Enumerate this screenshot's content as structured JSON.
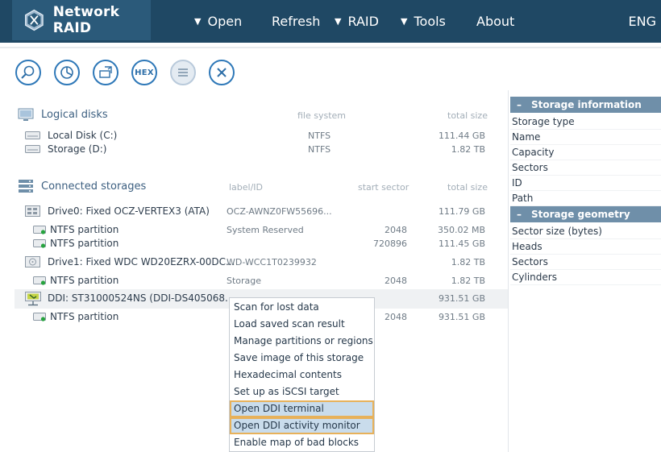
{
  "app": {
    "title": "Network RAID"
  },
  "menu": {
    "open": "Open",
    "refresh": "Refresh",
    "raid": "RAID",
    "tools": "Tools",
    "about": "About",
    "lang": "ENG"
  },
  "toolbar": {
    "icons": [
      "magnifier-icon",
      "pie-chart-icon",
      "save-disk-icon",
      "hex-icon",
      "list-icon",
      "close-icon"
    ],
    "hex_label": "HEX"
  },
  "logical_disks": {
    "title": "Logical disks",
    "col_fs": "file system",
    "col_size": "total size",
    "items": [
      {
        "name": "Local Disk (C:)",
        "fs": "NTFS",
        "size": "111.44 GB"
      },
      {
        "name": "Storage (D:)",
        "fs": "NTFS",
        "size": "1.82 TB"
      }
    ]
  },
  "connected": {
    "title": "Connected storages",
    "col_label": "label/ID",
    "col_sector": "start sector",
    "col_size": "total size",
    "rows": [
      {
        "name": "Drive0: Fixed OCZ-VERTEX3 (ATA)",
        "label": "OCZ-AWNZ0FW55696...",
        "sector": "",
        "size": "111.79 GB"
      },
      {
        "name": "NTFS partition",
        "label": "System Reserved",
        "sector": "2048",
        "size": "350.02 MB"
      },
      {
        "name": "NTFS partition",
        "label": "",
        "sector": "720896",
        "size": "111.45 GB"
      },
      {
        "name": "Drive1: Fixed WDC WD20EZRX-00DC...",
        "label": "WD-WCC1T0239932",
        "sector": "",
        "size": "1.82 TB"
      },
      {
        "name": "NTFS partition",
        "label": "Storage",
        "sector": "2048",
        "size": "1.82 TB"
      },
      {
        "name": "DDI: ST31000524NS (DDI-DS405068...",
        "label": "",
        "sector": "",
        "size": "931.51 GB"
      },
      {
        "name": "NTFS partition",
        "label": "",
        "sector": "2048",
        "size": "931.51 GB"
      }
    ]
  },
  "context_menu": [
    "Scan for lost data",
    "Load saved scan result",
    "Manage partitions or regions",
    "Save image of this storage",
    "Hexadecimal contents",
    "Set up as iSCSI target",
    "Open DDI terminal",
    "Open DDI activity monitor",
    "Enable map of bad blocks"
  ],
  "storage_info": {
    "title": "Storage information",
    "fields": [
      "Storage type",
      "Name",
      "Capacity",
      "Sectors",
      "ID",
      "Path"
    ]
  },
  "storage_geometry": {
    "title": "Storage geometry",
    "fields": [
      "Sector size (bytes)",
      "Heads",
      "Sectors",
      "Cylinders"
    ]
  },
  "colors": {
    "topbar": "#1f4864",
    "brand": "#2b5a7a",
    "accent": "#2e78b8",
    "panel_head": "#6f8fa9",
    "highlight_border": "#e7b15a",
    "highlight_fill": "#c9dcec"
  }
}
